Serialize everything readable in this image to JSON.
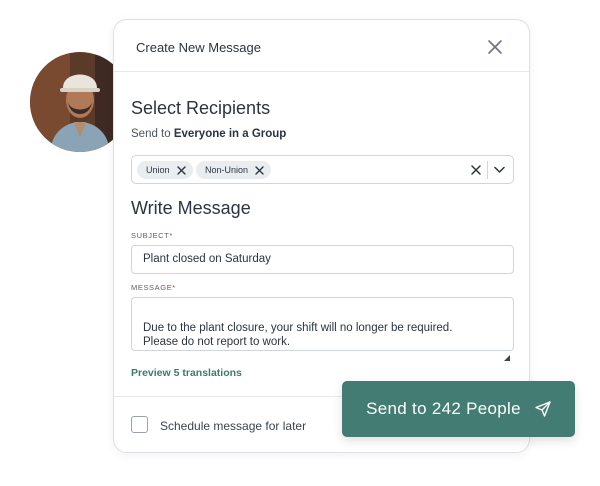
{
  "dialog": {
    "title": "Create New Message",
    "close_icon": "close-icon"
  },
  "recipients": {
    "heading": "Select Recipients",
    "send_to_prefix": "Send to",
    "send_to_value": "Everyone in a Group",
    "chips": [
      {
        "label": "Union"
      },
      {
        "label": "Non-Union"
      }
    ]
  },
  "message": {
    "heading": "Write Message",
    "subject_label": "SUBJECT",
    "subject_value": "Plant closed on Saturday",
    "message_label": "MESSAGE",
    "message_value": "Due to the plant closure, your shift will no longer be required.\nPlease do not report to work.",
    "required_marker": "*"
  },
  "preview_link": "Preview 5 translations",
  "schedule": {
    "label": "Schedule message for later",
    "checked": false
  },
  "send_button": {
    "label": "Send to 242 People",
    "icon": "send-icon"
  },
  "colors": {
    "accent": "#437c72",
    "link": "#3d7a6e",
    "required": "#c0392b",
    "chip_bg": "#e9edf0"
  }
}
